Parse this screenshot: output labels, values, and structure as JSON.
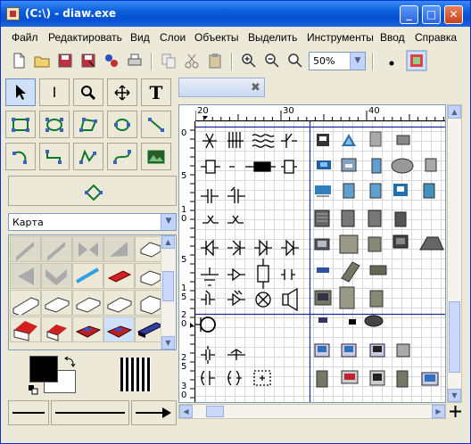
{
  "window": {
    "title": "(C:\\) - diaw.exe",
    "minimize_glyph": "_",
    "maximize_glyph": "□",
    "close_glyph": "✕"
  },
  "menu": [
    {
      "label": "Файл"
    },
    {
      "label": "Редактировать"
    },
    {
      "label": "Вид"
    },
    {
      "label": "Слои"
    },
    {
      "label": "Объекты"
    },
    {
      "label": "Выделить"
    },
    {
      "label": "Инструменты"
    },
    {
      "label": "Ввод"
    },
    {
      "label": "Справка"
    }
  ],
  "toolbar": {
    "zoom_value": "50%",
    "icons": [
      "new-icon",
      "open-icon",
      "save-icon",
      "save-as-icon",
      "export-icon",
      "print-icon",
      "copy-icon",
      "cut-icon",
      "paste-icon",
      "zoom-in-icon",
      "zoom-out-icon",
      "zoom-fit-icon"
    ]
  },
  "tools": {
    "row1": [
      "pointer-tool",
      "text-cursor-tool",
      "magnify-tool",
      "move-tool",
      "text-tool"
    ],
    "text_tool_glyph": "T",
    "text_cursor_glyph": "I"
  },
  "sheet_selector": {
    "value": "Карта"
  },
  "document": {
    "tab_close_glyph": "✖"
  },
  "ruler": {
    "h_labels": [
      "20",
      "30",
      "40"
    ],
    "v_labels": [
      "0",
      "5",
      "1",
      "0",
      "5",
      "1",
      "5",
      "2",
      "0",
      "2",
      "5",
      "3",
      "0"
    ]
  },
  "colors": {
    "foreground": "#000000",
    "background": "#ffffff",
    "accent_selection": "#cfe0fb",
    "titlebar": "#0a5fdc"
  }
}
